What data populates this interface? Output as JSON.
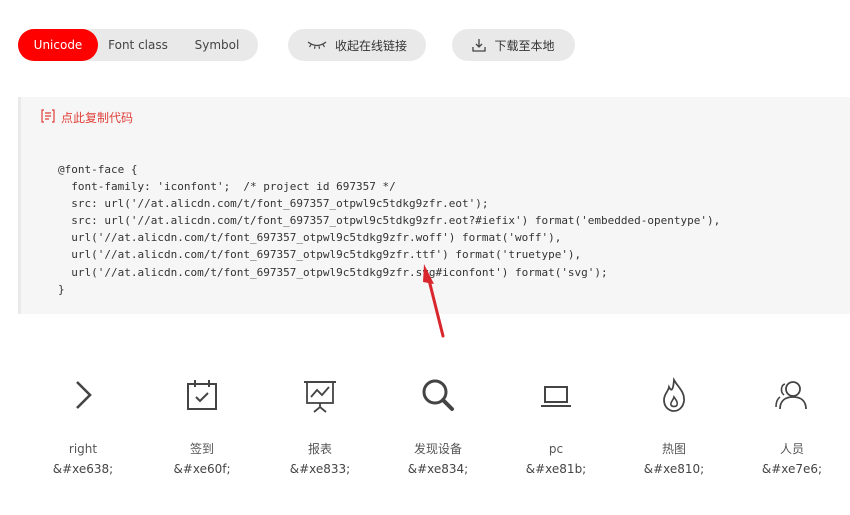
{
  "tabs": [
    {
      "label": "Unicode",
      "active": true
    },
    {
      "label": "Font class"
    },
    {
      "label": "Symbol"
    }
  ],
  "actions": {
    "collect_label": "收起在线链接",
    "download_label": "下载至本地"
  },
  "code_panel": {
    "copy_label": "点此复制代码",
    "lines": [
      "@font-face {",
      "  font-family: 'iconfont';  /* project id 697357 */",
      "  src: url('//at.alicdn.com/t/font_697357_otpwl9c5tdkg9zfr.eot');",
      "  src: url('//at.alicdn.com/t/font_697357_otpwl9c5tdkg9zfr.eot?#iefix') format('embedded-opentype'),",
      "  url('//at.alicdn.com/t/font_697357_otpwl9c5tdkg9zfr.woff') format('woff'),",
      "  url('//at.alicdn.com/t/font_697357_otpwl9c5tdkg9zfr.ttf') format('truetype'),",
      "  url('//at.alicdn.com/t/font_697357_otpwl9c5tdkg9zfr.svg#iconfont') format('svg');",
      "}"
    ]
  },
  "icons": [
    {
      "icon": "chevron-right-icon",
      "name": "right",
      "code": "&#xe638;"
    },
    {
      "icon": "calendar-check-icon",
      "name": "签到",
      "code": "&#xe60f;"
    },
    {
      "icon": "presentation-chart-icon",
      "name": "报表",
      "code": "&#xe833;"
    },
    {
      "icon": "search-icon",
      "name": "发现设备",
      "code": "&#xe834;"
    },
    {
      "icon": "laptop-icon",
      "name": "pc",
      "code": "&#xe81b;"
    },
    {
      "icon": "flame-icon",
      "name": "热图",
      "code": "&#xe810;"
    },
    {
      "icon": "users-icon",
      "name": "人员",
      "code": "&#xe7e6;"
    }
  ],
  "colors": {
    "accent": "#ff0000",
    "annotation_arrow": "#d9262c",
    "copy_link": "#e0403a",
    "icon_stroke": "#444444"
  }
}
